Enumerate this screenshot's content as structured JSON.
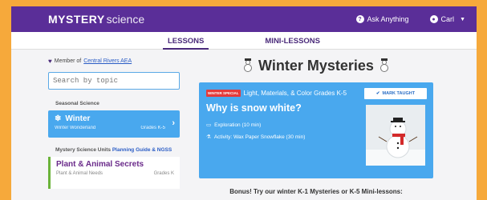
{
  "header": {
    "logo_bold": "MYSTERY",
    "logo_light": "science",
    "ask_label": "Ask Anything",
    "user_label": "Carl"
  },
  "tabs": [
    {
      "label": "LESSONS",
      "active": true
    },
    {
      "label": "MINI-LESSONS",
      "active": false
    }
  ],
  "sidebar": {
    "member_prefix": "Member of",
    "member_org": "Central Rivers AEA",
    "search_placeholder": "Search by topic",
    "seasonal_title": "Seasonal Science",
    "winter_card": {
      "title": "Winter",
      "subtitle": "Winter Wonderland",
      "grades": "Grades K-5"
    },
    "units_title": "Mystery Science Units",
    "units_link": "Planning Guide & NGSS",
    "unit_card": {
      "title": "Plant & Animal Secrets",
      "subtitle": "Plant & Animal Needs",
      "grades": "Grades K"
    }
  },
  "main": {
    "title": "Winter Mysteries",
    "card": {
      "badge": "WINTER SPECIAL",
      "tagline": "Light, Materials, & Color Grades K-5",
      "title": "Why is snow white?",
      "exploration": "Exploration (10 min)",
      "activity": "Activity: Wax Paper Snowflake (30 min)",
      "mark_button": "MARK TAUGHT"
    },
    "bonus": "Bonus! Try our winter K-1 Mysteries or K-5 Mini-lessons:"
  },
  "colors": {
    "brand_purple": "#5a2e98",
    "card_blue": "#49a8ee",
    "page_orange": "#f6a93b"
  }
}
